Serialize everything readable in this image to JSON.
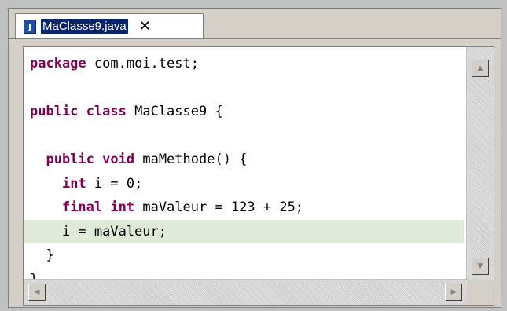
{
  "tab": {
    "icon_glyph": "J",
    "title": "MaClasse9.java",
    "close_glyph": "✕"
  },
  "code_lines": [
    [
      {
        "kw": true,
        "t": "package"
      },
      {
        "kw": false,
        "t": " com.moi.test;"
      }
    ],
    [],
    [
      {
        "kw": true,
        "t": "public"
      },
      {
        "kw": false,
        "t": " "
      },
      {
        "kw": true,
        "t": "class"
      },
      {
        "kw": false,
        "t": " MaClasse9 {"
      }
    ],
    [],
    [
      {
        "kw": false,
        "t": "  "
      },
      {
        "kw": true,
        "t": "public"
      },
      {
        "kw": false,
        "t": " "
      },
      {
        "kw": true,
        "t": "void"
      },
      {
        "kw": false,
        "t": " maMethode() {"
      }
    ],
    [
      {
        "kw": false,
        "t": "    "
      },
      {
        "kw": true,
        "t": "int"
      },
      {
        "kw": false,
        "t": " i = 0;"
      }
    ],
    [
      {
        "kw": false,
        "t": "    "
      },
      {
        "kw": true,
        "t": "final"
      },
      {
        "kw": false,
        "t": " "
      },
      {
        "kw": true,
        "t": "int"
      },
      {
        "kw": false,
        "t": " maValeur = 123 + 25;"
      }
    ],
    [
      {
        "kw": false,
        "t": "    i = maValeur;"
      }
    ],
    [
      {
        "kw": false,
        "t": "  }"
      }
    ],
    [
      {
        "kw": false,
        "t": "}"
      }
    ]
  ],
  "highlighted_line": 7,
  "scroll": {
    "up_glyph": "▲",
    "down_glyph": "▼",
    "left_glyph": "◀",
    "right_glyph": "▶"
  },
  "colors": {
    "keyword": "#7f0055",
    "current_line": "#e0ead8",
    "tab_selection": "#0a246a"
  }
}
